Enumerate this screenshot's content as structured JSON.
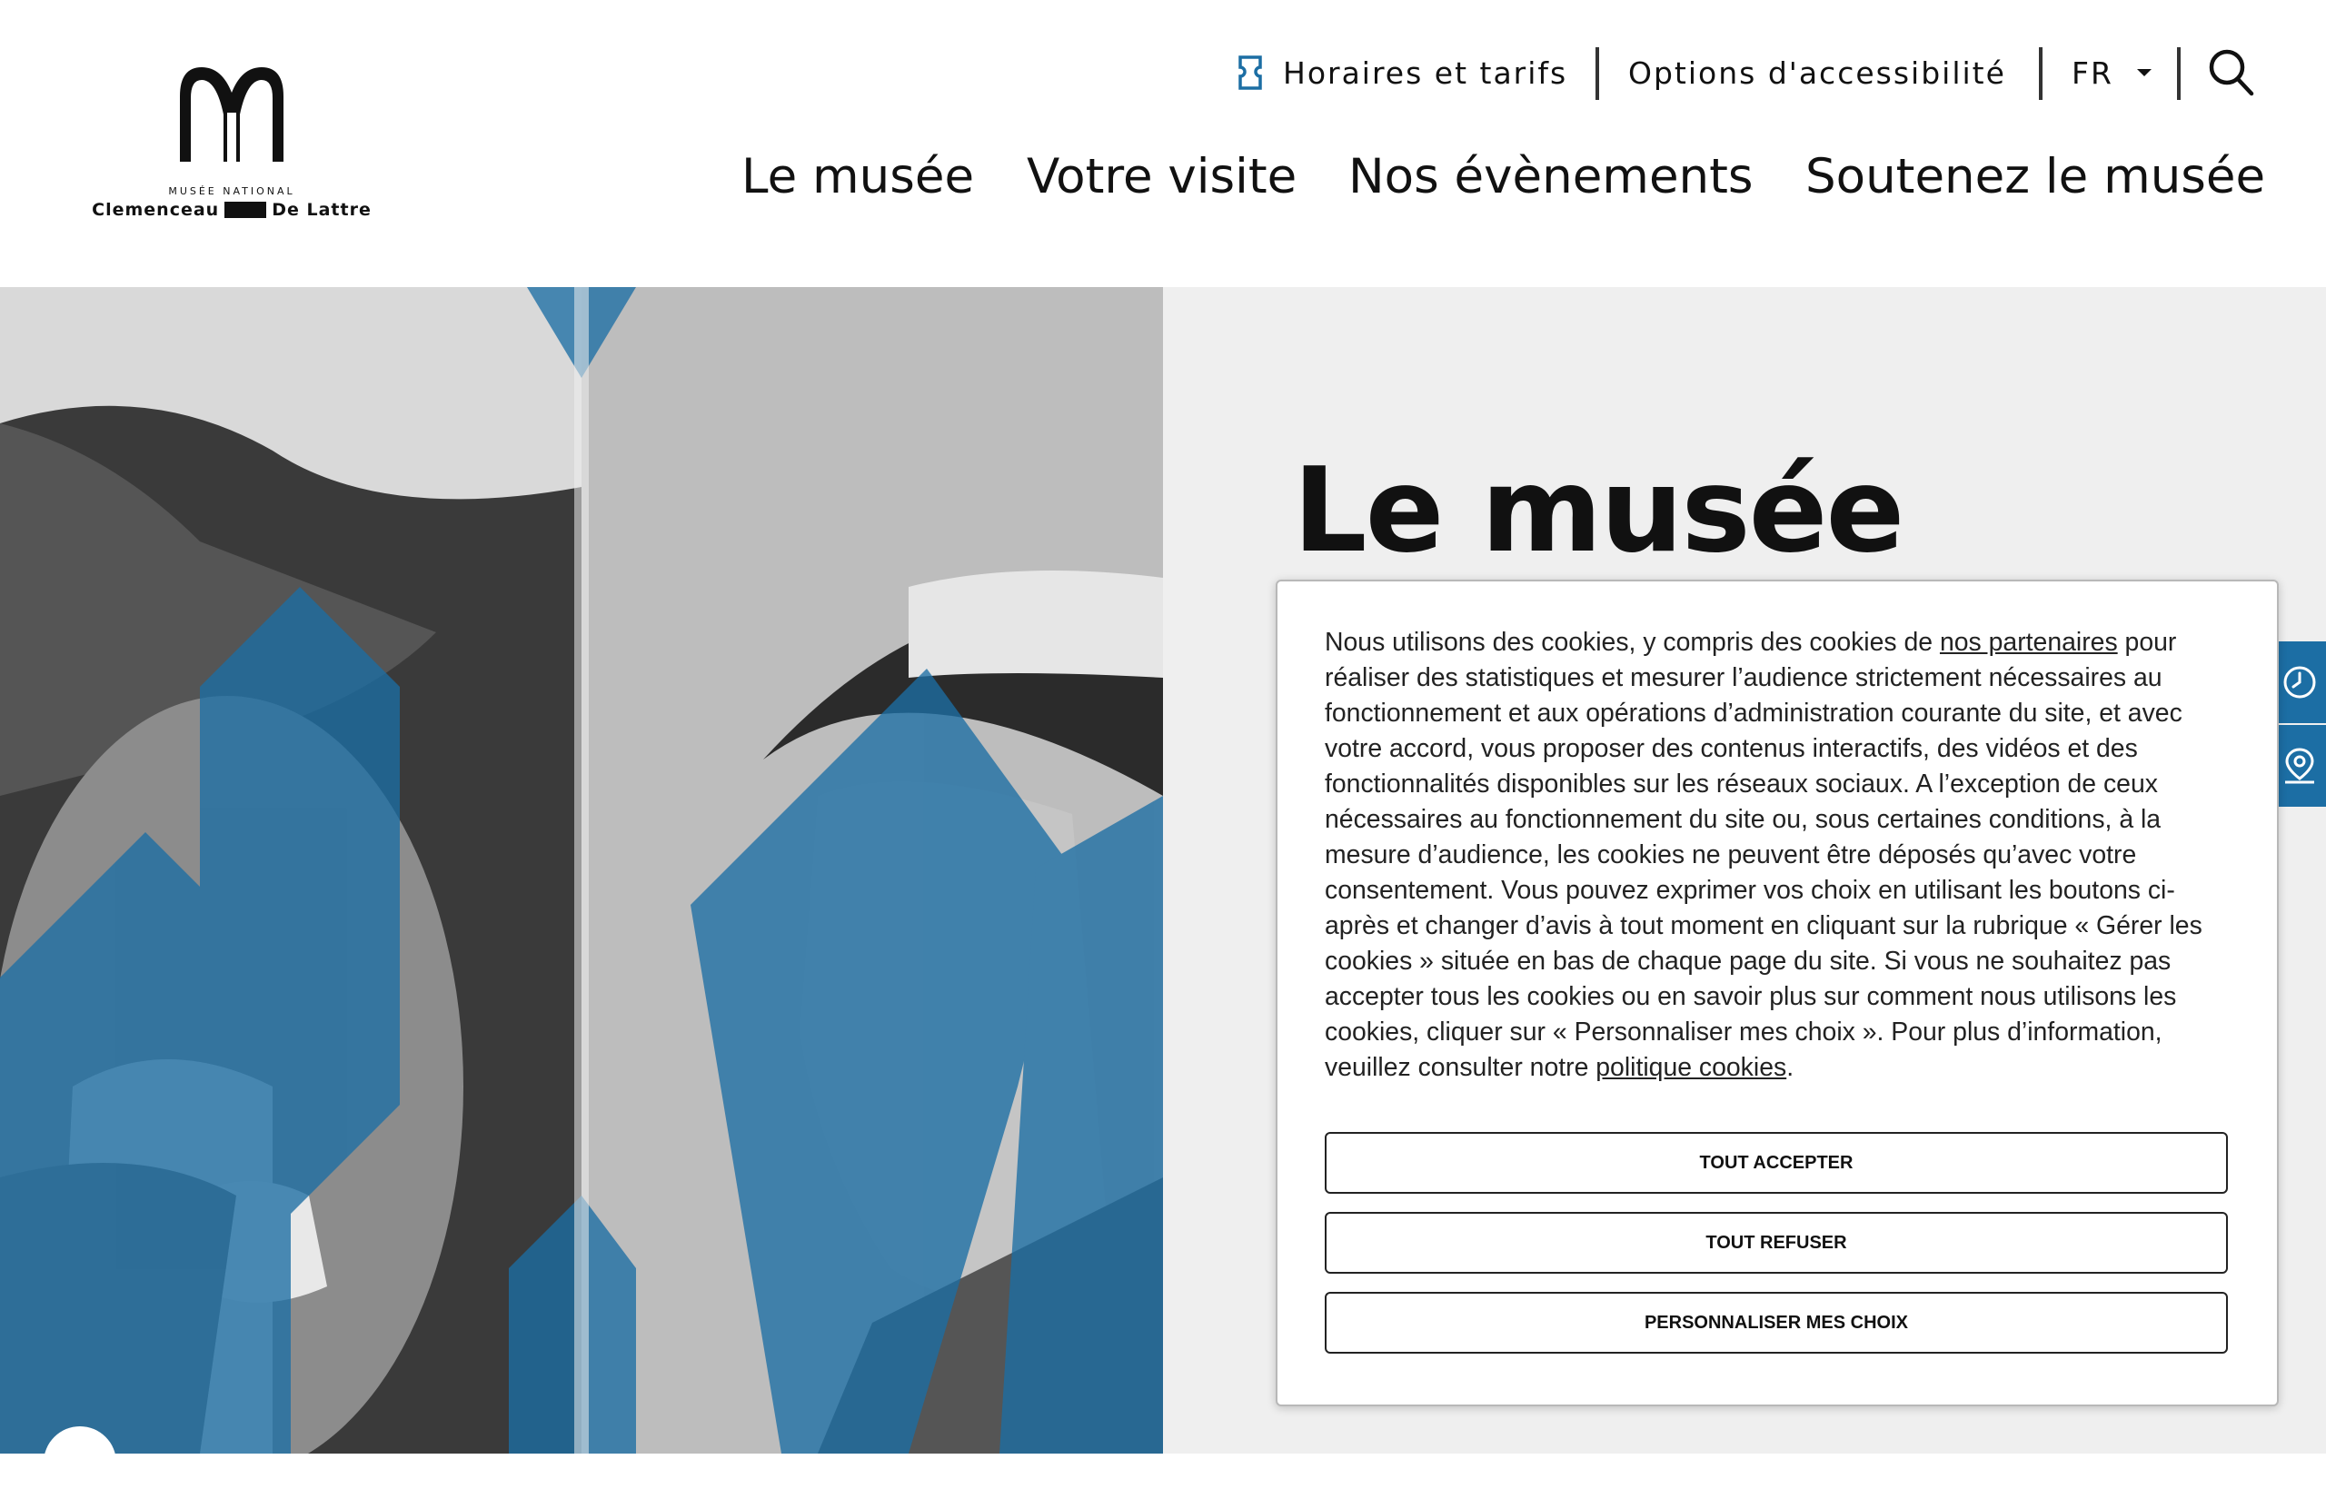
{
  "header": {
    "logo": {
      "subtitle": "MUSÉE NATIONAL",
      "name_left": "Clemenceau",
      "name_right": "De Lattre"
    },
    "utility": {
      "hours_label": "Horaires et tarifs",
      "accessibility_label": "Options d'accessibilité",
      "language": "FR"
    },
    "nav": [
      {
        "label": "Le musée"
      },
      {
        "label": "Votre visite"
      },
      {
        "label": "Nos évènements"
      },
      {
        "label": "Soutenez le musée"
      }
    ]
  },
  "hero": {
    "title": "Le musée"
  },
  "cookie_banner": {
    "text_1": "Nous utilisons des cookies, y compris des cookies de ",
    "partners_link": "nos partenaires",
    "text_2": " pour réaliser des statistiques et mesurer l’audience strictement nécessaires au fonctionnement et aux opérations d’administration courante du site, et avec votre accord, vous proposer des contenus interactifs, des vidéos et des fonctionnalités disponibles sur les réseaux sociaux. A l’exception de ceux nécessaires au fonctionnement du site ou, sous certaines conditions, à la mesure d’audience, les cookies ne peuvent être déposés qu’avec votre consentement. Vous pouvez exprimer vos choix en utilisant les boutons ci-après et changer d’avis à tout moment en cliquant sur la rubrique « Gérer les cookies » située en bas de chaque page du site. Si vous ne souhaitez pas accepter tous les cookies ou en savoir plus sur comment nous utilisons les cookies, cliquer sur « Personnaliser mes choix ». Pour plus d’information, veuillez consulter notre ",
    "policy_link": "politique cookies",
    "text_3": ".",
    "accept_label": "TOUT ACCEPTER",
    "refuse_label": "TOUT REFUSER",
    "customize_label": "PERSONNALISER MES CHOIX"
  },
  "side_tabs": [
    {
      "icon": "clock-icon"
    },
    {
      "icon": "map-pin-icon"
    }
  ],
  "colors": {
    "accent_blue": "#1c6ea4",
    "hero_right_bg": "#efefef",
    "text": "#111111"
  }
}
